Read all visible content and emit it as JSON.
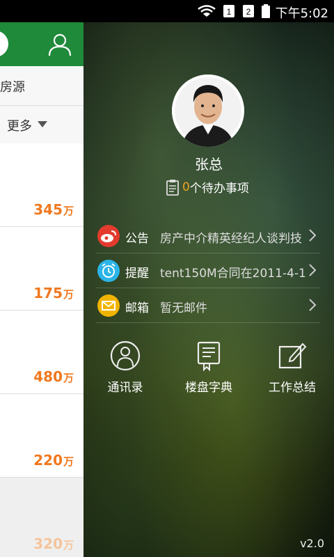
{
  "status_bar": {
    "time": "下午5:02"
  },
  "left_list": {
    "tab_label": "房源",
    "filter_label": "更多",
    "items": [
      {
        "price": "345",
        "unit": "万"
      },
      {
        "price": "175",
        "unit": "万"
      },
      {
        "price": "480",
        "unit": "万"
      },
      {
        "price": "220",
        "unit": "万"
      },
      {
        "price": "320",
        "unit": "万"
      }
    ]
  },
  "drawer": {
    "user_name": "张总",
    "todo": {
      "count": "0",
      "text": "个待办事项"
    },
    "rows": [
      {
        "label": "公告",
        "text": "房产中介精英经纪人谈判技",
        "icon": "weibo-icon",
        "color": "#e33b2e"
      },
      {
        "label": "提醒",
        "text": "tent150M合同在2011-4-1",
        "icon": "alarm-icon",
        "color": "#2bb4e8"
      },
      {
        "label": "邮箱",
        "text": "暂无邮件",
        "icon": "mail-icon",
        "color": "#f0b400"
      }
    ],
    "shortcuts": [
      {
        "label": "通讯录",
        "icon": "contacts-icon"
      },
      {
        "label": "楼盘字典",
        "icon": "book-icon"
      },
      {
        "label": "工作总结",
        "icon": "edit-icon"
      }
    ],
    "version": "v2.0"
  }
}
